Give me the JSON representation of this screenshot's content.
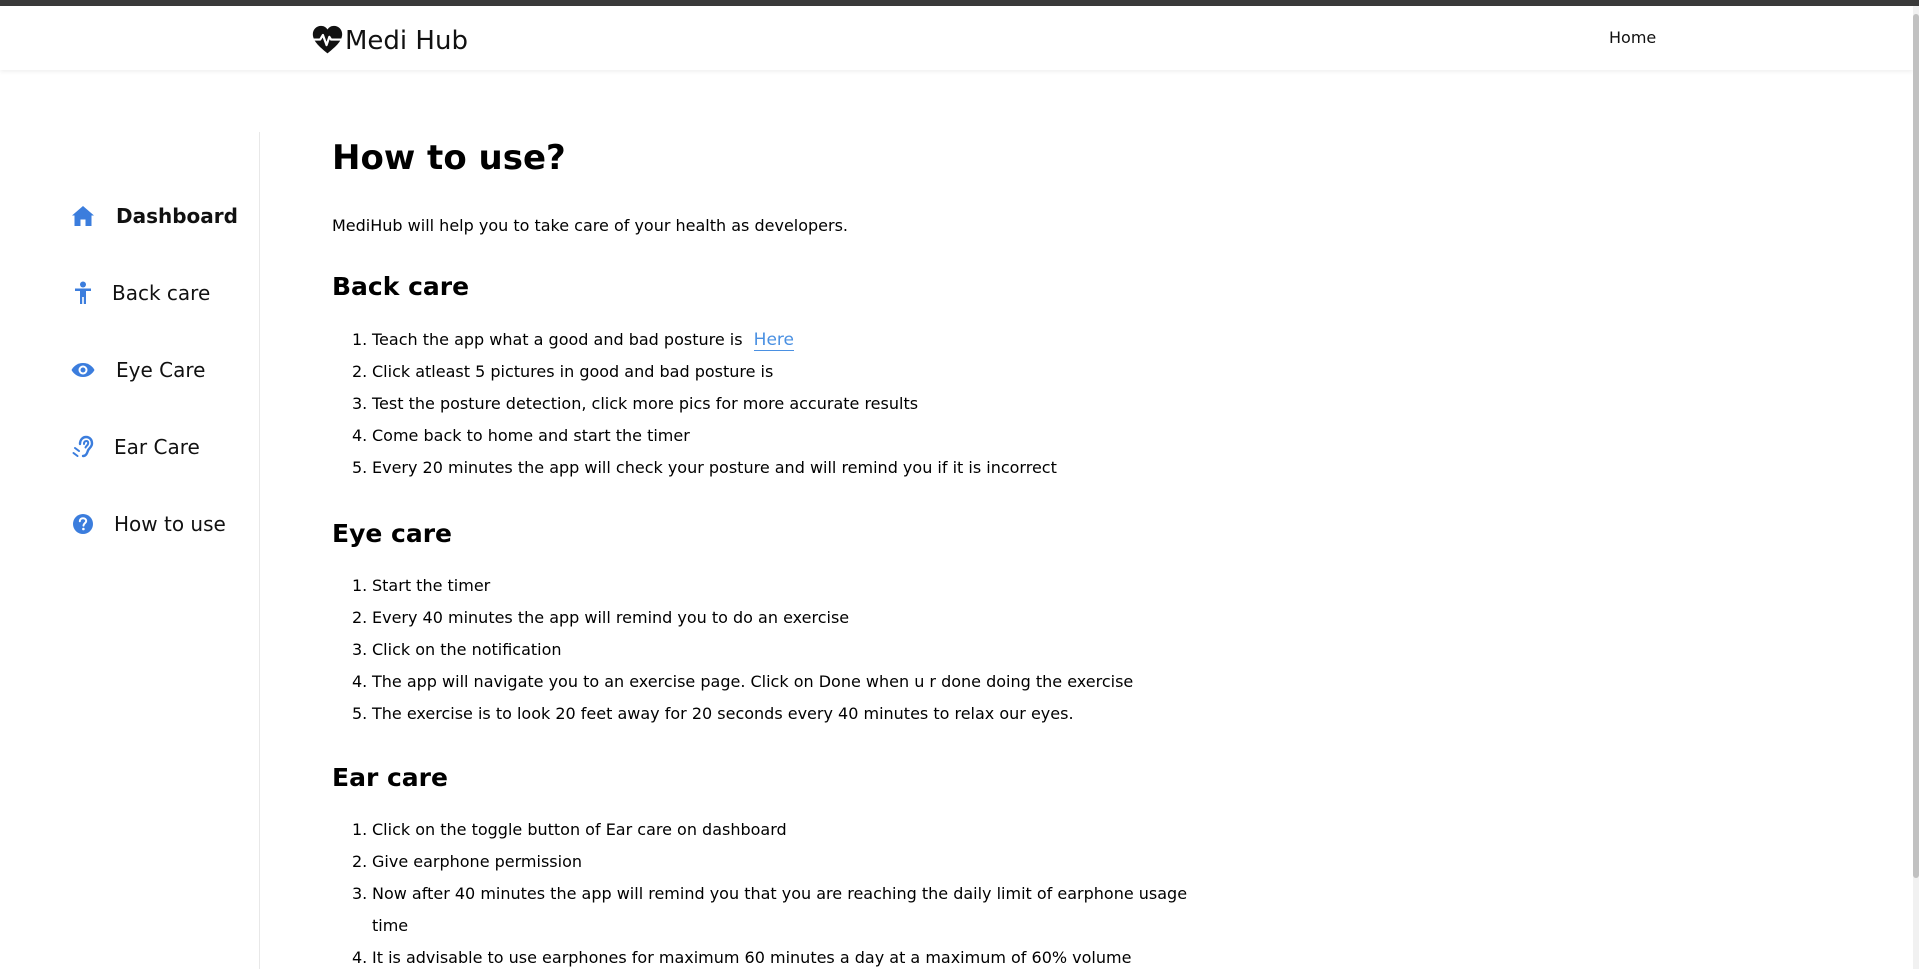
{
  "header": {
    "brand": "Medi Hub",
    "nav_home": "Home"
  },
  "sidebar": {
    "items": [
      {
        "label": "Dashboard",
        "icon": "home-icon"
      },
      {
        "label": "Back care",
        "icon": "person-icon"
      },
      {
        "label": "Eye Care",
        "icon": "eye-icon"
      },
      {
        "label": "Ear Care",
        "icon": "ear-icon"
      },
      {
        "label": "How to use",
        "icon": "question-icon"
      }
    ],
    "accent_color": "#3b7ddd"
  },
  "main": {
    "title": "How to use?",
    "intro": "MediHub will help you to take care of your health as developers.",
    "sections": [
      {
        "heading": "Back care",
        "steps": [
          "Teach the app what a good and bad posture is",
          "Click atleast 5 pictures in good and bad posture is",
          "Test the posture detection, click more pics for more accurate results",
          "Come back to home and start the timer",
          "Every 20 minutes the app will check your posture and will remind you if it is incorrect"
        ],
        "link_label": "Here"
      },
      {
        "heading": "Eye care",
        "steps": [
          "Start the timer",
          "Every 40 minutes the app will remind you to do an exercise",
          "Click on the notification",
          "The app will navigate you to an exercise page. Click on Done when u r done doing the exercise",
          "The exercise is to look 20 feet away for 20 seconds every 40 minutes to relax our eyes."
        ]
      },
      {
        "heading": "Ear care",
        "steps": [
          "Click on the toggle button of Ear care on dashboard",
          "Give earphone permission",
          "Now after 40 minutes the app will remind you that you are reaching the daily limit of earphone usage time",
          "It is advisable to use earphones for maximum 60 minutes a day at a maximum of 60% volume"
        ]
      }
    ]
  }
}
